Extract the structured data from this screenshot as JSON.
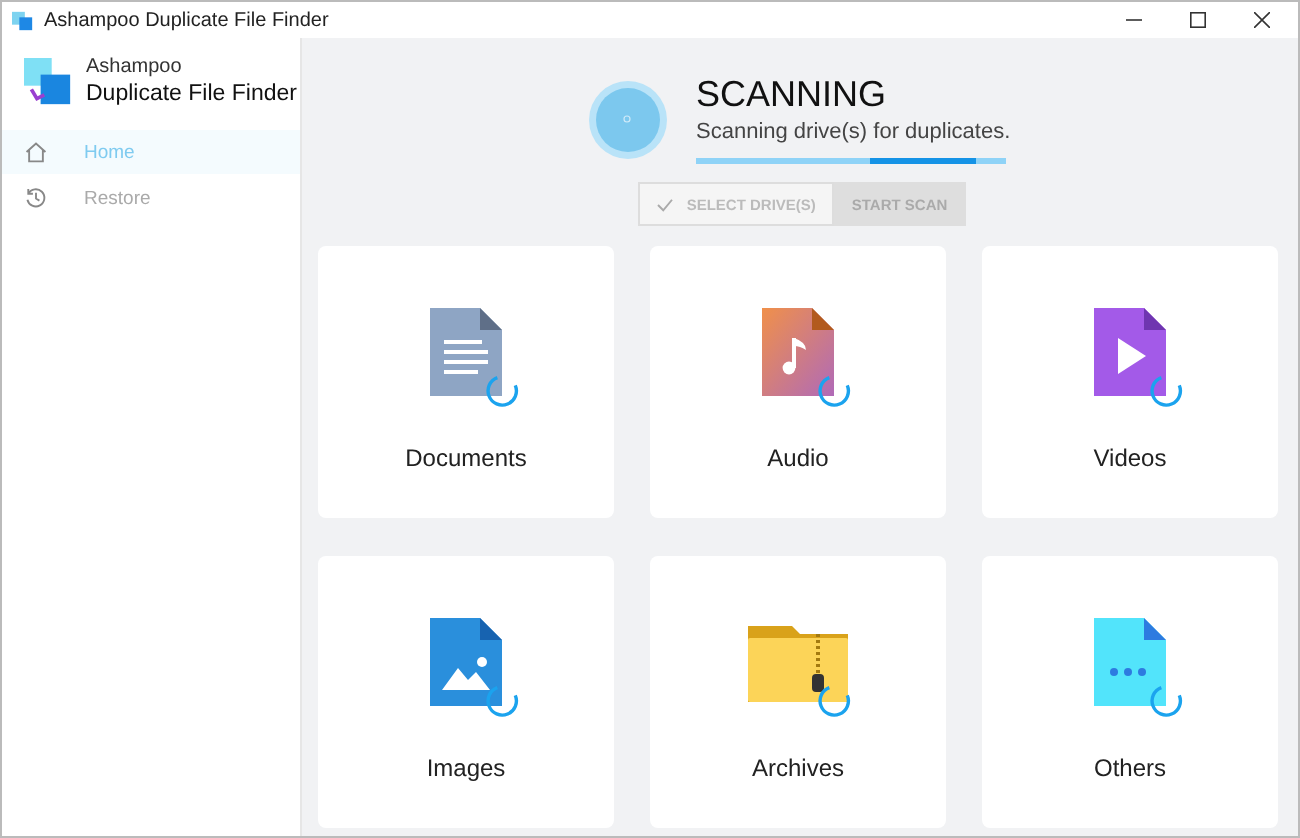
{
  "window": {
    "title": "Ashampoo Duplicate File Finder"
  },
  "app": {
    "brand": "Ashampoo",
    "product": "Duplicate File Finder"
  },
  "sidebar": {
    "items": [
      {
        "label": "Home",
        "selected": true
      },
      {
        "label": "Restore",
        "selected": false
      }
    ]
  },
  "status": {
    "title": "SCANNING",
    "subtitle": "Scanning drive(s) for duplicates.",
    "level": 0.9
  },
  "buttons": [
    {
      "label": "SELECT DRIVE(S)",
      "kind": "check",
      "disabled": true
    },
    {
      "label": "START SCAN",
      "kind": "plain",
      "disabled": true
    }
  ],
  "categories": [
    {
      "label": "Documents",
      "kind": "documents",
      "scanning": true
    },
    {
      "label": "Audio",
      "kind": "audio",
      "scanning": true
    },
    {
      "label": "Videos",
      "kind": "videos",
      "scanning": true
    },
    {
      "label": "Images",
      "kind": "images",
      "scanning": true
    },
    {
      "label": "Archives",
      "kind": "archives",
      "scanning": true
    },
    {
      "label": "Others",
      "kind": "others",
      "scanning": true
    }
  ]
}
